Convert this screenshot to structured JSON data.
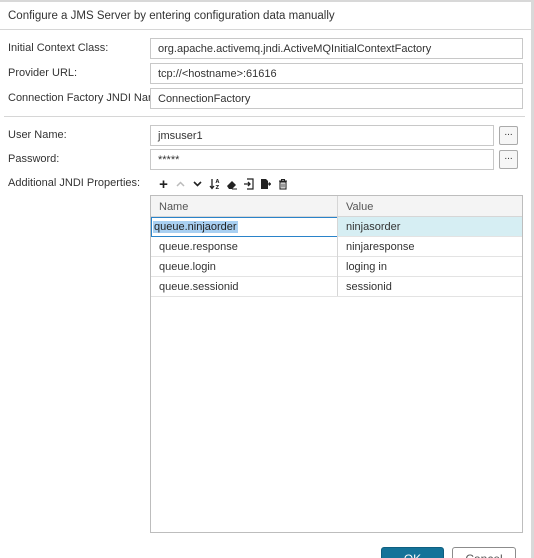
{
  "dialog": {
    "title": "Configure a JMS Server by entering configuration data manually"
  },
  "form": {
    "initial_context_label": "Initial Context Class:",
    "initial_context_value": "org.apache.activemq.jndi.ActiveMQInitialContextFactory",
    "provider_url_label": "Provider URL:",
    "provider_url_value": "tcp://<hostname>:61616",
    "jndi_name_label": "Connection Factory JNDI Name:",
    "jndi_name_value": "ConnectionFactory",
    "username_label": "User Name:",
    "username_value": "jmsuser1",
    "password_label": "Password:",
    "password_value": "*****",
    "browse_label": "...",
    "jndi_props_label": "Additional JNDI Properties:"
  },
  "toolbar": {
    "icons": [
      "add-icon",
      "move-up-icon",
      "move-down-icon",
      "sort-icon",
      "eraser-icon",
      "import-icon",
      "export-icon",
      "delete-icon"
    ],
    "add_glyph": "+",
    "up_glyph": "∧",
    "down_glyph": "∨"
  },
  "table": {
    "headers": {
      "name": "Name",
      "value": "Value"
    },
    "rows": [
      {
        "name": "queue.ninjaorder",
        "value": "ninjasorder"
      },
      {
        "name": "queue.response",
        "value": "ninjaresponse"
      },
      {
        "name": "queue.login",
        "value": "loging in"
      },
      {
        "name": "queue.sessionid",
        "value": "sessionid"
      }
    ]
  },
  "buttons": {
    "ok": "OK",
    "cancel": "Cancel"
  },
  "colors": {
    "primary": "#147399",
    "selection": "#d6eef3",
    "edit_border": "#2a83c9"
  }
}
